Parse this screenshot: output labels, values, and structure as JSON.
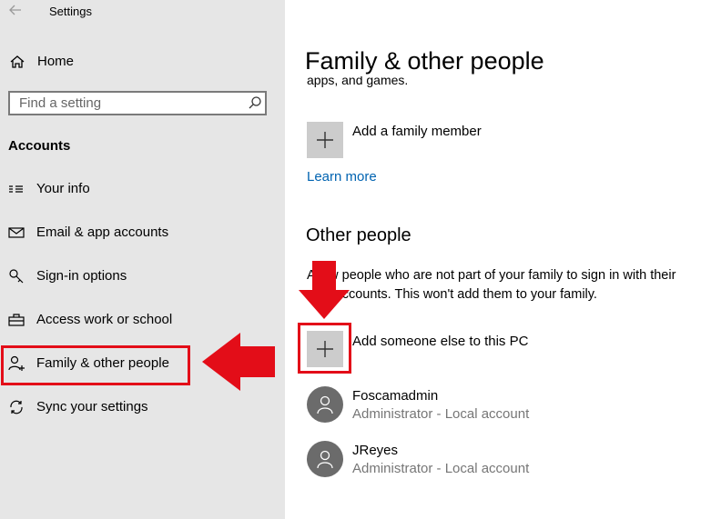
{
  "window": {
    "title": "Settings"
  },
  "sidebar": {
    "home_label": "Home",
    "search_placeholder": "Find a setting",
    "section": "Accounts",
    "items": [
      {
        "label": "Your info",
        "icon": "contact-card-icon"
      },
      {
        "label": "Email & app accounts",
        "icon": "mail-icon"
      },
      {
        "label": "Sign-in options",
        "icon": "key-icon"
      },
      {
        "label": "Access work or school",
        "icon": "briefcase-icon"
      },
      {
        "label": "Family & other people",
        "icon": "add-person-icon",
        "selected": true
      },
      {
        "label": "Sync your settings",
        "icon": "sync-icon"
      }
    ]
  },
  "main": {
    "title": "Family & other people",
    "cut_text": "apps, and games.",
    "add_family_label": "Add a family member",
    "learn_more": "Learn more",
    "other_people_heading": "Other people",
    "other_people_desc_line1": "Allow people who are not part of your family to sign in with their",
    "other_people_desc_line2": "own accounts. This won't add them to your family.",
    "add_someone_label": "Add someone else to this PC",
    "users": [
      {
        "name": "Foscamadmin",
        "role": "Administrator - Local account"
      },
      {
        "name": "JReyes",
        "role": "Administrator - Local account"
      }
    ]
  },
  "colors": {
    "sidebar_bg": "#e6e6e6",
    "accent_link": "#0063b1",
    "annotation_red": "#e30d18",
    "tile_gray": "#cccccc",
    "avatar_gray": "#6b6b6b"
  }
}
